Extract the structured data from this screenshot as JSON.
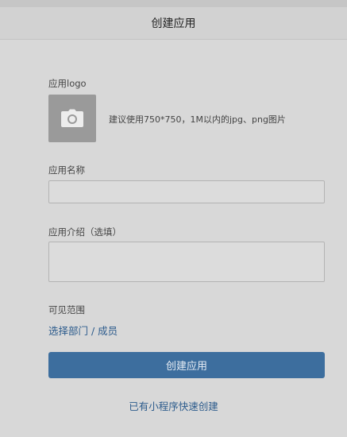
{
  "header": {
    "title": "创建应用"
  },
  "form": {
    "logo": {
      "label": "应用logo",
      "icon": "camera-icon",
      "hint": "建议使用750*750，1M以内的jpg、png图片"
    },
    "name": {
      "label": "应用名称",
      "value": "",
      "placeholder": ""
    },
    "intro": {
      "label": "应用介绍（选填）",
      "value": "",
      "placeholder": ""
    },
    "scope": {
      "label": "可见范围",
      "link": "选择部门 / 成员"
    },
    "submit_label": "创建应用",
    "quick_create_link": "已有小程序快速创建"
  },
  "colors": {
    "primary": "#3d6e9e",
    "link": "#2c5b8c",
    "background": "#d8d8d8"
  }
}
